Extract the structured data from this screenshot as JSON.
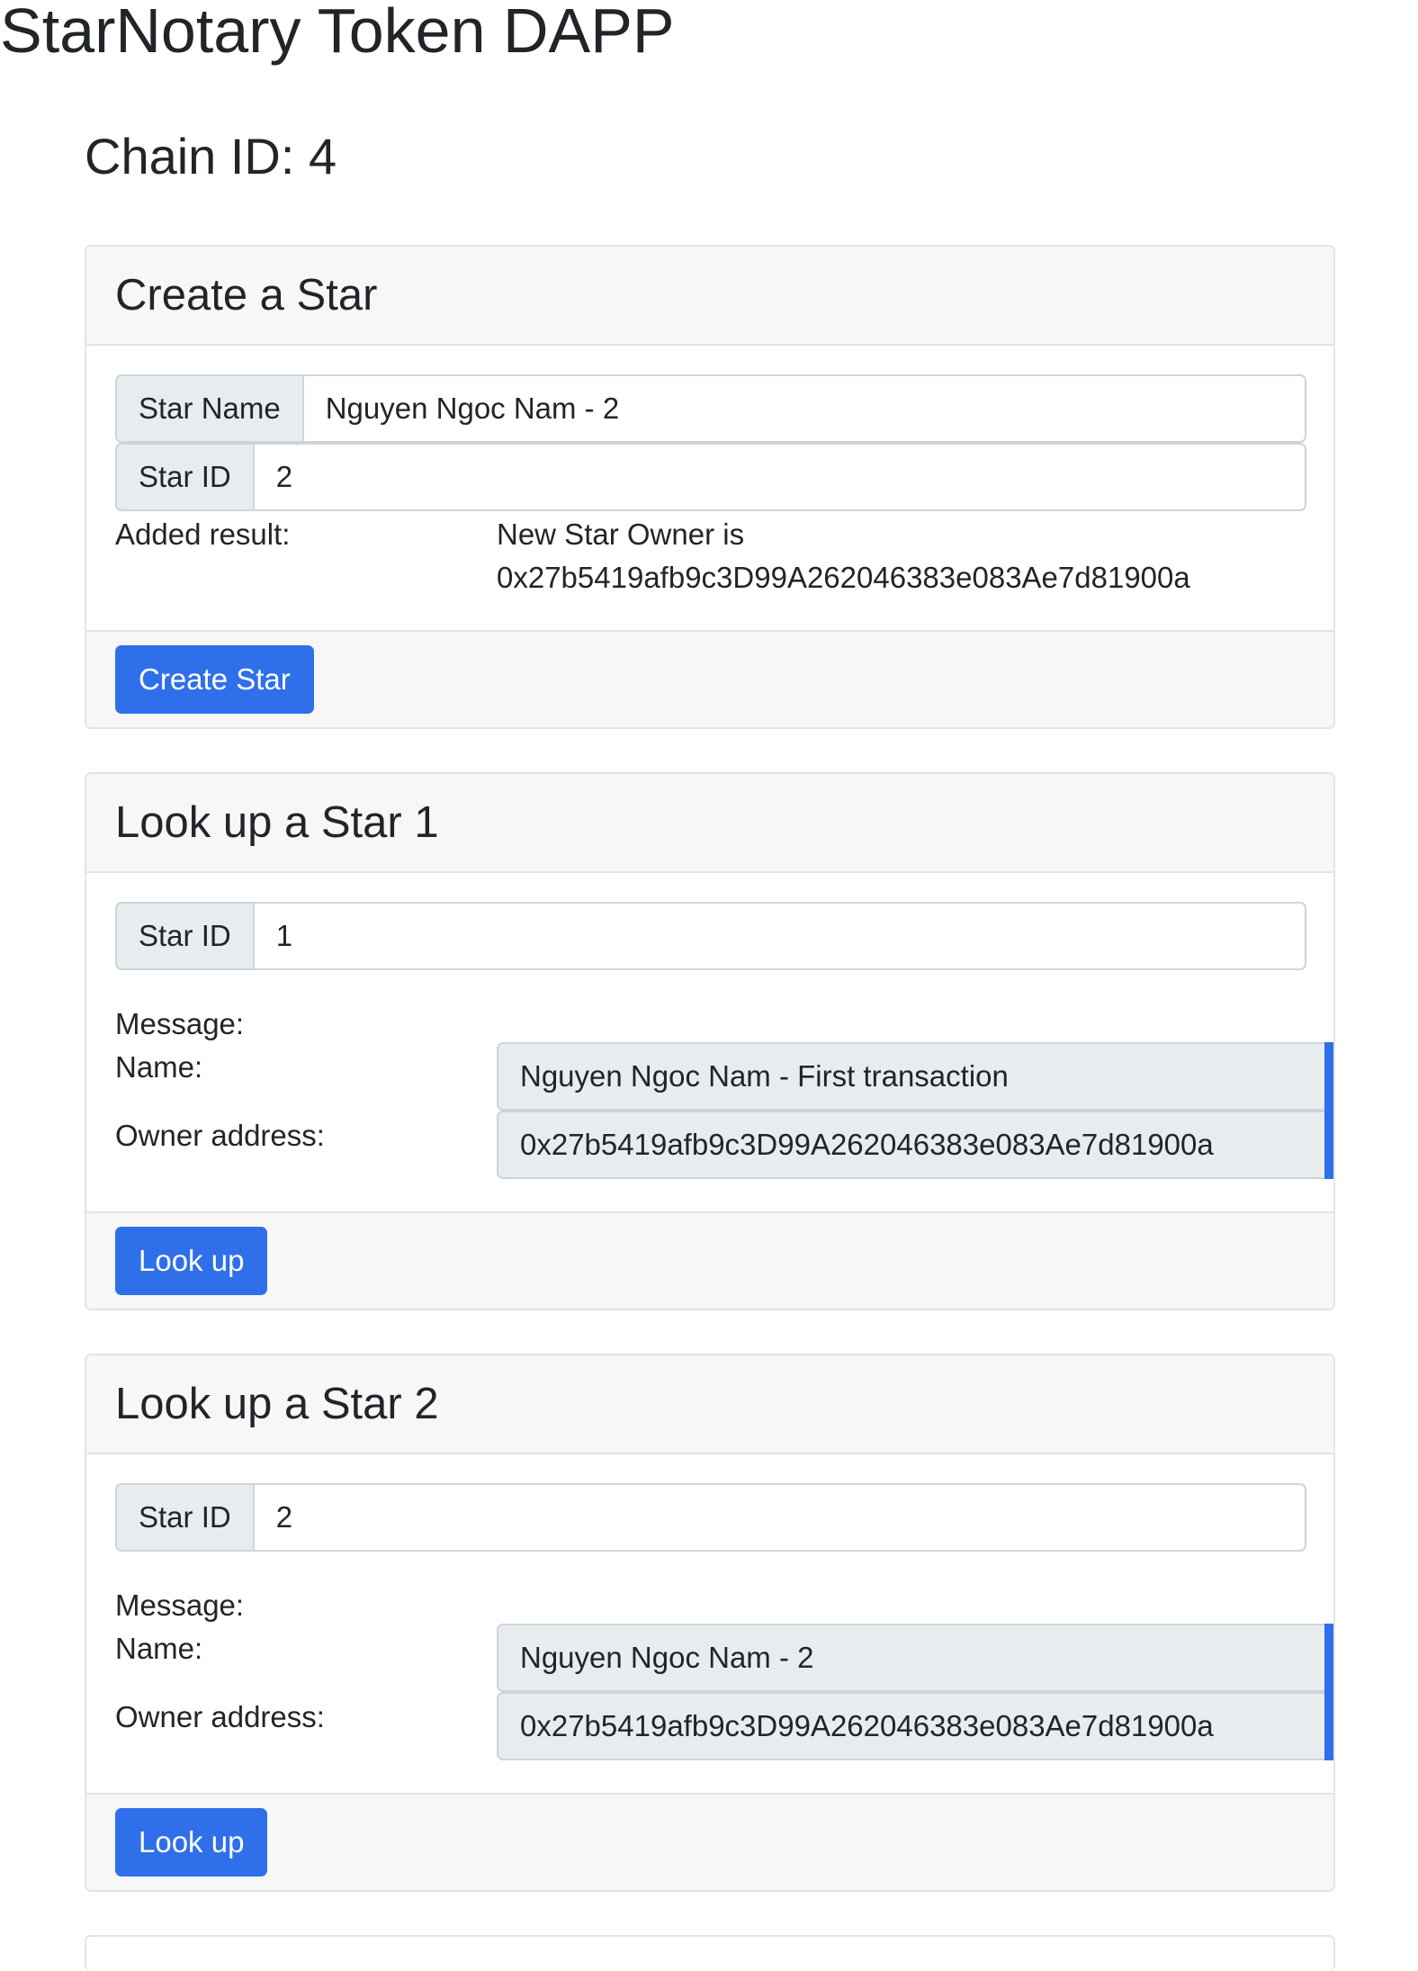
{
  "app": {
    "title": "StarNotary Token DAPP"
  },
  "chain": {
    "label": "Chain ID: 4"
  },
  "create": {
    "title": "Create a Star",
    "star_name_label": "Star Name",
    "star_name_value": "Nguyen Ngoc Nam - 2",
    "star_id_label": "Star ID",
    "star_id_value": "2",
    "result_label": "Added result:",
    "result_line1": "New Star Owner is",
    "result_line2": "0x27b5419afb9c3D99A262046383e083Ae7d81900a",
    "button_label": "Create Star"
  },
  "lookup1": {
    "title": "Look up a Star 1",
    "star_id_label": "Star ID",
    "star_id_value": "1",
    "message_label": "Message:",
    "name_label": "Name:",
    "name_value": "Nguyen Ngoc Nam - First transaction",
    "owner_label": "Owner address:",
    "owner_value": "0x27b5419afb9c3D99A262046383e083Ae7d81900a",
    "button_label": "Look up"
  },
  "lookup2": {
    "title": "Look up a Star 2",
    "star_id_label": "Star ID",
    "star_id_value": "2",
    "message_label": "Message:",
    "name_label": "Name:",
    "name_value": "Nguyen Ngoc Nam - 2",
    "owner_label": "Owner address:",
    "owner_value": "0x27b5419afb9c3D99A262046383e083Ae7d81900a",
    "button_label": "Look up"
  },
  "icons": {
    "copy": "copy-icon"
  },
  "colors": {
    "primary": "#2f6fea",
    "header_bg": "#f7f7f7",
    "readonly_bg": "#e9ecef"
  }
}
